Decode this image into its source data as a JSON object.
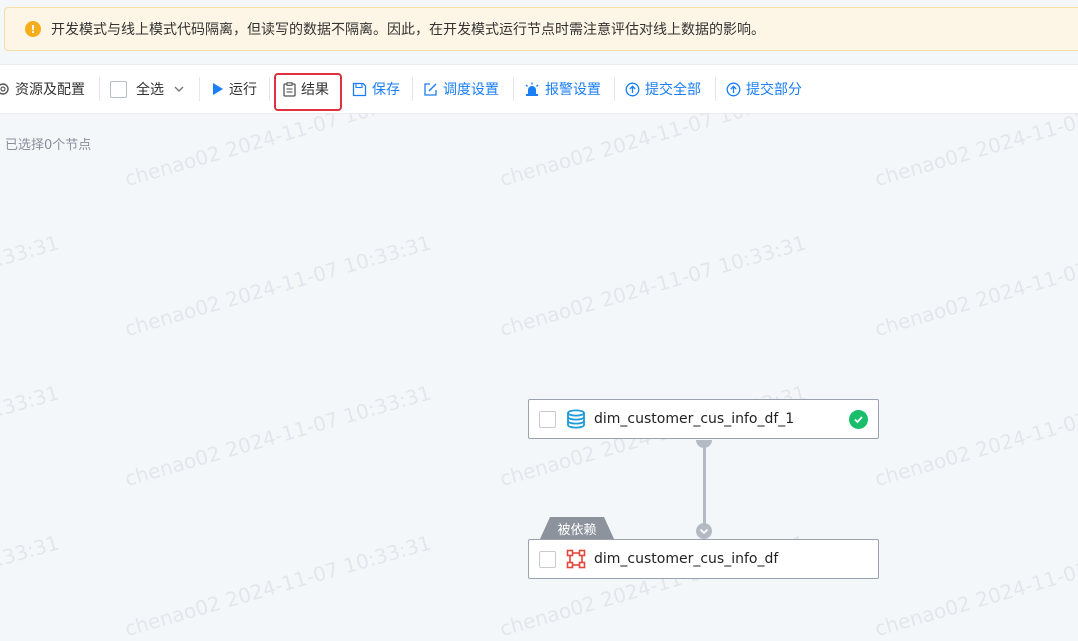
{
  "banner": {
    "icon": "warning-icon",
    "text": "开发模式与线上模式代码隔离，但读写的数据不隔离。因此，在开发模式运行节点时需注意评估对线上数据的影响。"
  },
  "toolbar": {
    "resources_label": "资源及配置",
    "select_all_label": "全选",
    "run_label": "运行",
    "result_label": "结果",
    "save_label": "保存",
    "schedule_label": "调度设置",
    "alarm_label": "报警设置",
    "submit_all_label": "提交全部",
    "submit_part_label": "提交部分"
  },
  "selection": {
    "count_text": "已选择0个节点"
  },
  "watermark": {
    "text": "chenao02 2024-11-07 10:33:31"
  },
  "graph": {
    "nodes": [
      {
        "name": "dim_customer_cus_info_df_1",
        "icon": "database-icon",
        "status": "success"
      },
      {
        "name": "dim_customer_cus_info_df",
        "icon": "transform-node-icon",
        "tag": "被依赖"
      }
    ]
  },
  "colors": {
    "accent": "#1a7ef5",
    "warning": "#f6ad1c",
    "success": "#19be6b",
    "highlight": "#e0323e"
  }
}
